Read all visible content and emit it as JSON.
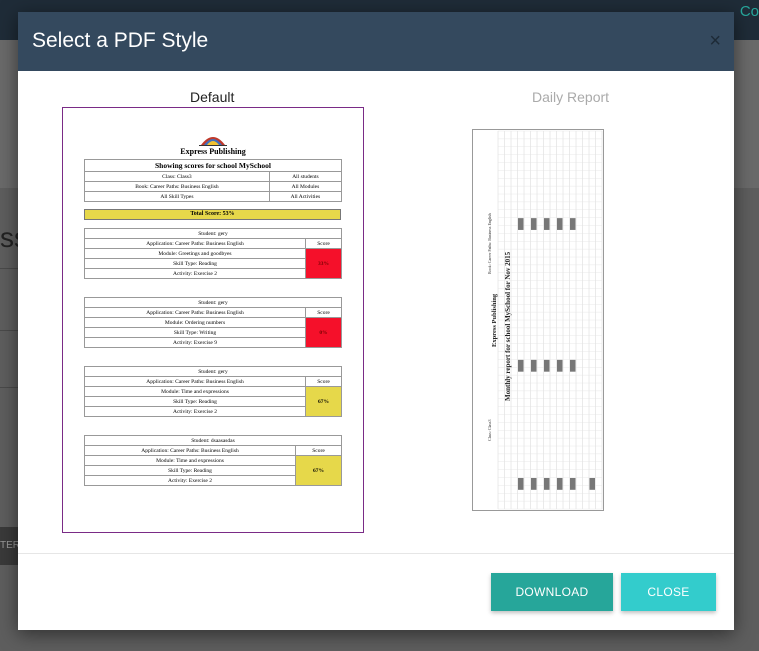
{
  "background": {
    "corner_text": "Co",
    "title_text": "ss",
    "button_text": "TERS"
  },
  "modal": {
    "title": "Select a PDF Style",
    "close_symbol": "×",
    "styles": [
      {
        "label": "Default",
        "selected": true
      },
      {
        "label": "Daily Report",
        "selected": false
      }
    ],
    "buttons": {
      "download": "DOWNLOAD",
      "close": "CLOSE"
    }
  },
  "preview": {
    "brand": "Express Publishing",
    "header_title": "Showing scores for school MySchool",
    "class": "Class: Class3",
    "students": "All students",
    "book": "Book: Career Paths: Business English",
    "modules": "All Modules",
    "skills": "All Skill Types",
    "activities": "All Activities",
    "total": "Total Score: 53%",
    "score_header": "Score",
    "blocks": [
      {
        "student": "Student: gery",
        "application": "Application: Career Paths: Business English",
        "module": "Module: Greetings and goodbyes",
        "skill": "Skill Type: Reading",
        "activity": "Activity: Exercise 2",
        "score": "33%",
        "color": "red"
      },
      {
        "student": "Student: gery",
        "application": "Application: Career Paths: Business English",
        "module": "Module: Ordering numbers",
        "skill": "Skill Type: Writing",
        "activity": "Activity: Exercise 9",
        "score": "0%",
        "color": "red"
      },
      {
        "student": "Student: gery",
        "application": "Application: Career Paths: Business English",
        "module": "Module: Time and expressions",
        "skill": "Skill Type: Reading",
        "activity": "Activity: Exercise 2",
        "score": "67%",
        "color": "yellow"
      },
      {
        "student": "Student: dsaasasdas",
        "application": "Application: Career Paths: Business English",
        "module": "Module: Time and expressions",
        "skill": "Skill Type: Reading",
        "activity": "Activity: Exercise 2",
        "score": "67%",
        "color": "yellow"
      }
    ],
    "daily": {
      "title": "Monthly report for school MySchool for Nov 2015",
      "brand": "Express Publishing",
      "class": "Class: Class3",
      "book": "Book: Career Paths: Business English"
    }
  }
}
